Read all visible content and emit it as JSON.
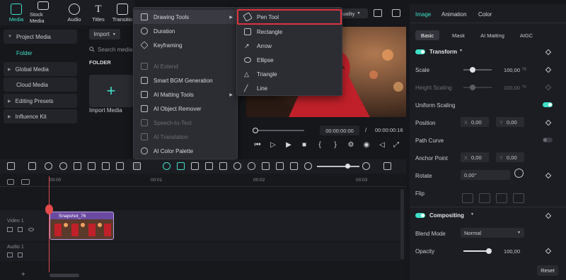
{
  "topbar": {
    "tabs": [
      {
        "label": "Media",
        "icon": "media-icon",
        "active": true
      },
      {
        "label": "Stock Media",
        "icon": "stock-media-icon"
      },
      {
        "label": "Audio",
        "icon": "audio-icon"
      },
      {
        "label": "Titles",
        "icon": "titles-icon"
      },
      {
        "label": "Transitio",
        "icon": "transitions-icon"
      }
    ]
  },
  "sidebar": {
    "items": [
      {
        "label": "Project Media"
      },
      {
        "label": "Folder"
      },
      {
        "label": "Global Media"
      },
      {
        "label": "Cloud Media"
      },
      {
        "label": "Editing Presets"
      },
      {
        "label": "Influence Kit"
      }
    ]
  },
  "media": {
    "import_label": "Import",
    "search_placeholder": "Search media",
    "folder_label": "FOLDER",
    "import_media_label": "Import Media"
  },
  "context_menu": {
    "items": [
      {
        "label": "Drawing Tools",
        "submenu": true,
        "highlighted": true
      },
      {
        "label": "Duration"
      },
      {
        "label": "Keyframing"
      },
      {
        "label": "AI Extend",
        "disabled": true
      },
      {
        "label": "Smart BGM Generation"
      },
      {
        "label": "AI Matting Tools",
        "submenu": true
      },
      {
        "label": "AI Object Remover"
      },
      {
        "label": "Speech-to-Text",
        "disabled": true
      },
      {
        "label": "AI Translation",
        "disabled": true
      },
      {
        "label": "AI Color Palette"
      }
    ]
  },
  "drawing_menu": {
    "items": [
      {
        "label": "Pen Tool",
        "selected": true
      },
      {
        "label": "Rectangle"
      },
      {
        "label": "Arrow"
      },
      {
        "label": "Ellipse"
      },
      {
        "label": "Triangle"
      },
      {
        "label": "Line"
      }
    ]
  },
  "player": {
    "quality_label": "uality",
    "current_time": "00:00:00:00",
    "separator": "/",
    "total_time": "00:00:00:16"
  },
  "right_panel": {
    "tabs": [
      "Image",
      "Animation",
      "Color"
    ],
    "subtabs": [
      "Basic",
      "Mask",
      "AI Matting",
      "AIGC"
    ],
    "transform": {
      "title": "Transform",
      "scale_label": "Scale",
      "scale_value": "100,00",
      "scale_unit": "%",
      "height_label": "Height Scaling",
      "height_value": "100,00",
      "height_unit": "%",
      "uniform_label": "Uniform Scaling",
      "position_label": "Position",
      "pos_x": "0,00",
      "pos_y": "0,00",
      "path_curve_label": "Path Curve",
      "anchor_label": "Anchor Point",
      "anchor_x": "0,00",
      "anchor_y": "0,00",
      "rotate_label": "Rotate",
      "rotate_value": "0,00°",
      "flip_label": "Flip",
      "x_prefix": "X",
      "y_prefix": "Y"
    },
    "compositing": {
      "title": "Compositing",
      "blend_label": "Blend Mode",
      "blend_value": "Normal",
      "opacity_label": "Opacity",
      "opacity_value": "100,00"
    },
    "reset_label": "Reset"
  },
  "timeline": {
    "ruler": [
      "00:00",
      "00:01",
      "00:02",
      "00:03"
    ],
    "tracks": [
      {
        "label": "Video 1"
      },
      {
        "label": "Audio 1"
      }
    ],
    "clip_label": "Snapshot_76"
  },
  "colors": {
    "accent": "#3fe0c8",
    "highlight_border": "#e0323c",
    "clip": "#6a4aa0"
  }
}
